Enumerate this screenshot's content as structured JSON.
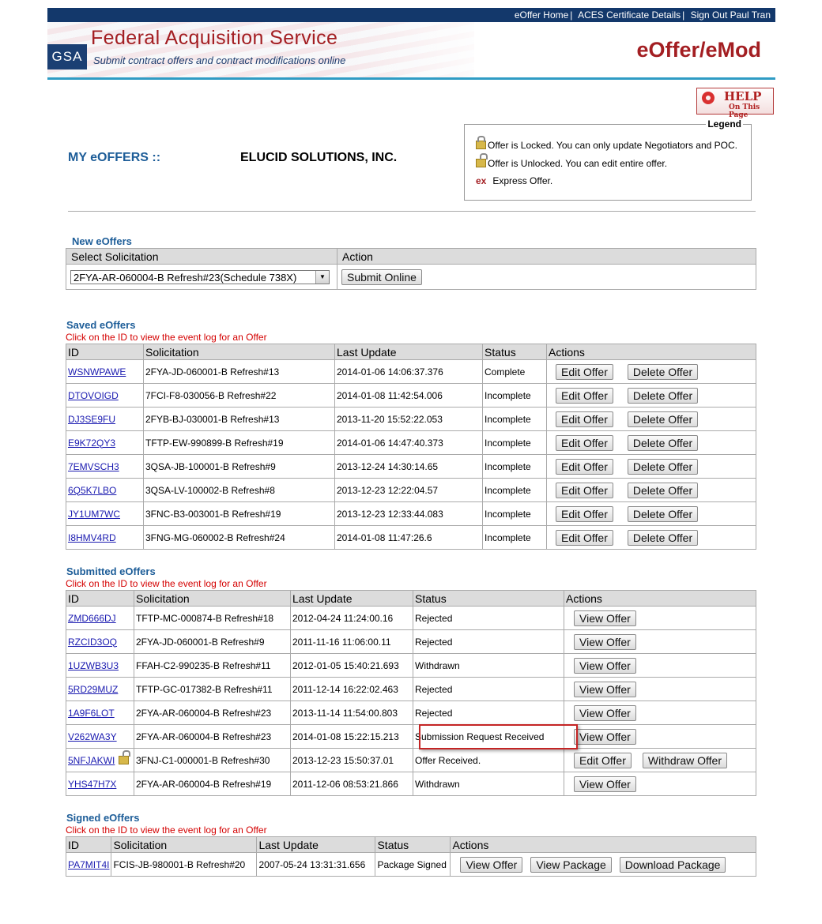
{
  "header": {
    "links": [
      "eOffer Home",
      "ACES Certificate Details",
      "Sign Out Paul Tran"
    ],
    "logo": "GSA",
    "org_title": "Federal Acquisition Service",
    "org_subtitle": "Submit contract offers and contract modifications online",
    "app_title": "eOffer/eMod",
    "help_main": "HELP",
    "help_sub": "On This Page"
  },
  "page": {
    "heading": "MY eOFFERS ::",
    "company": "ELUCID SOLUTIONS, INC."
  },
  "legend": {
    "title": "Legend",
    "locked": "Offer is Locked. You can only update Negotiators and POC.",
    "unlocked": "Offer is Unlocked. You can edit entire offer.",
    "express_mark": "ex",
    "express": "Express Offer."
  },
  "new_offers": {
    "title": "New eOffers",
    "col_select": "Select Solicitation",
    "col_action": "Action",
    "selected": "2FYA-AR-060004-B Refresh#23(Schedule 738X)",
    "submit_label": "Submit Online"
  },
  "hint": "Click on the ID to view the event log for an Offer",
  "saved": {
    "title": "Saved eOffers",
    "headers": [
      "ID",
      "Solicitation",
      "Last Update",
      "Status",
      "Actions"
    ],
    "edit_label": "Edit Offer",
    "delete_label": "Delete Offer",
    "rows": [
      {
        "id": "WSNWPAWE",
        "sol": "2FYA-JD-060001-B Refresh#13",
        "upd": "2014-01-06 14:06:37.376",
        "status": "Complete"
      },
      {
        "id": "DTOVOIGD",
        "sol": "7FCI-F8-030056-B Refresh#22",
        "upd": "2014-01-08 11:42:54.006",
        "status": "Incomplete"
      },
      {
        "id": "DJ3SE9FU",
        "sol": "2FYB-BJ-030001-B Refresh#13",
        "upd": "2013-11-20 15:52:22.053",
        "status": "Incomplete"
      },
      {
        "id": "E9K72QY3",
        "sol": "TFTP-EW-990899-B Refresh#19",
        "upd": "2014-01-06 14:47:40.373",
        "status": "Incomplete"
      },
      {
        "id": "7EMVSCH3",
        "sol": "3QSA-JB-100001-B Refresh#9",
        "upd": "2013-12-24 14:30:14.65",
        "status": "Incomplete"
      },
      {
        "id": "6Q5K7LBO",
        "sol": "3QSA-LV-100002-B Refresh#8",
        "upd": "2013-12-23 12:22:04.57",
        "status": "Incomplete"
      },
      {
        "id": "JY1UM7WC",
        "sol": "3FNC-B3-003001-B Refresh#19",
        "upd": "2013-12-23 12:33:44.083",
        "status": "Incomplete"
      },
      {
        "id": "I8HMV4RD",
        "sol": "3FNG-MG-060002-B Refresh#24",
        "upd": "2014-01-08 11:47:26.6",
        "status": "Incomplete"
      }
    ]
  },
  "submitted": {
    "title": "Submitted eOffers",
    "headers": [
      "ID",
      "Solicitation",
      "Last Update",
      "Status",
      "Actions"
    ],
    "view_label": "View Offer",
    "edit_label": "Edit Offer",
    "withdraw_label": "Withdraw Offer",
    "rows": [
      {
        "id": "ZMD666DJ",
        "sol": "TFTP-MC-000874-B Refresh#18",
        "upd": "2012-04-24 11:24:00.16",
        "status": "Rejected"
      },
      {
        "id": "RZCID3OQ",
        "sol": "2FYA-JD-060001-B Refresh#9",
        "upd": "2011-11-16 11:06:00.11",
        "status": "Rejected"
      },
      {
        "id": "1UZWB3U3",
        "sol": "FFAH-C2-990235-B Refresh#11",
        "upd": "2012-01-05 15:40:21.693",
        "status": "Withdrawn"
      },
      {
        "id": "5RD29MUZ",
        "sol": "TFTP-GC-017382-B Refresh#11",
        "upd": "2011-12-14 16:22:02.463",
        "status": "Rejected"
      },
      {
        "id": "1A9F6LOT",
        "sol": "2FYA-AR-060004-B Refresh#23",
        "upd": "2013-11-14 11:54:00.803",
        "status": "Rejected"
      },
      {
        "id": "V262WA3Y",
        "sol": "2FYA-AR-060004-B Refresh#23",
        "upd": "2014-01-08 15:22:15.213",
        "status": "Submission Request Received"
      },
      {
        "id": "5NFJAKWI",
        "sol": "3FNJ-C1-000001-B Refresh#30",
        "upd": "2013-12-23 15:50:37.01",
        "status": "Offer Received."
      },
      {
        "id": "YHS47H7X",
        "sol": "2FYA-AR-060004-B Refresh#19",
        "upd": "2011-12-06 08:53:21.866",
        "status": "Withdrawn"
      }
    ]
  },
  "signed": {
    "title": "Signed eOffers",
    "headers": [
      "ID",
      "Solicitation",
      "Last Update",
      "Status",
      "Actions"
    ],
    "view_label": "View Offer",
    "view_pkg_label": "View Package",
    "download_label": "Download Package",
    "rows": [
      {
        "id": "PA7MIT4I",
        "sol": "FCIS-JB-980001-B Refresh#20",
        "upd": "2007-05-24 13:31:31.656",
        "status": "Package Signed"
      }
    ]
  },
  "colors": {
    "brand_navy": "#13386b",
    "brand_red": "#a31e22",
    "accent_blue": "#2f9cc4",
    "hint_red": "#d40000"
  }
}
